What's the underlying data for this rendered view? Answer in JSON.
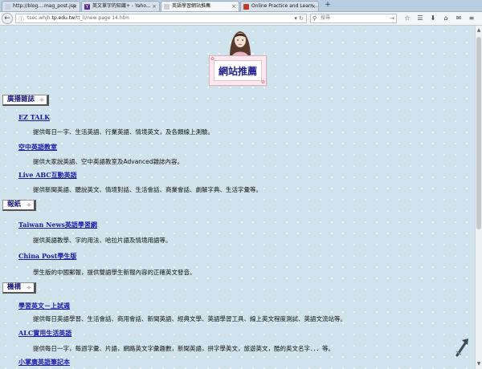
{
  "browser": {
    "tabs": [
      {
        "label": "http://blog....mag_post.jsp",
        "active": false,
        "icon": "page-icon",
        "color": "#c9d3df"
      },
      {
        "label": "英文單字的知識+ - Yaho...",
        "active": false,
        "icon": "yahoo-icon",
        "color": "#5b2d90"
      },
      {
        "label": "英語學習網站推薦",
        "active": true,
        "icon": "page-icon",
        "color": "#c9d3df"
      },
      {
        "label": "Online Practice and Learn...",
        "active": false,
        "icon": "cambridge-icon",
        "color": "#c0392b"
      }
    ],
    "close_glyph": "×",
    "new_tab_glyph": "+",
    "url_host": "tp.edu.tw",
    "url_prefix": "tsec.whjh.",
    "url_suffix": "/tt_li/new page 14.htm",
    "search_placeholder": "搜尋"
  },
  "page": {
    "title": "網站推薦",
    "sections": [
      {
        "label": "廣播雜誌",
        "items": [
          {
            "name": "EZ TALK",
            "desc": "提供每日一字、生活英語、行業英語、情境英文，及各類線上測驗。"
          },
          {
            "name": "空中英語教室",
            "desc": "提供大家說英語、空中英語教室及Advanced雜誌內容。"
          },
          {
            "name": "Live ABC互動英語",
            "desc": "提供新聞英語、聽說英文、情境對話、生活會話、商業會話、劇解字典、生活字彙等。"
          }
        ]
      },
      {
        "label": "報紙",
        "items": [
          {
            "name": "Taiwan News英語學習網",
            "desc": "提供英語教學、字的用法、哈拉片語及情境用語等。"
          },
          {
            "name": "China Post學生版",
            "desc": "學生版的中國郵報，提供雙語學生新報內容的正確英文發音。"
          }
        ]
      },
      {
        "label": "機構",
        "items": [
          {
            "name": "學習英文－上試週",
            "desc": "提供每日英語學習、生活會話、商用會話、新聞英語、經典文學、英語學習工具、線上英文程度測試、英語文流站等。"
          },
          {
            "name": "ALC實用生活英語",
            "desc": "提供每日一字，每週字彙、片語，網路英文字彙趣數，新聞英語，拼字學英文，旅遊英文，酷的英文名字．．．等。"
          },
          {
            "name": "小掌廣英語筆記本",
            "desc": ""
          }
        ]
      }
    ]
  }
}
